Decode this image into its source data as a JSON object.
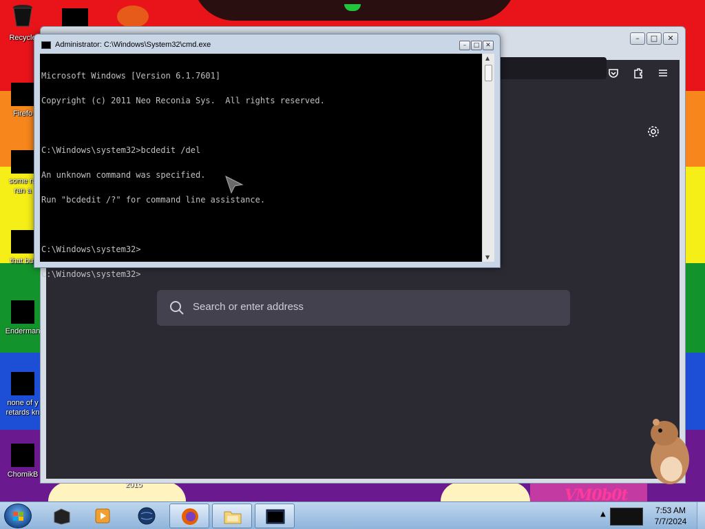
{
  "desktop": {
    "icons": [
      {
        "label": "Recycle",
        "icon": "recycle-bin-icon"
      },
      {
        "label": "Firefo",
        "icon": "firefox-icon"
      },
      {
        "label": "some ru",
        "label2": "ran a",
        "icon": "file-icon"
      },
      {
        "label": "that but",
        "icon": "file-icon"
      },
      {
        "label": "Enderman",
        "icon": "app-icon"
      },
      {
        "label": "none of y",
        "label2": "retards kn",
        "icon": "file-icon"
      },
      {
        "label": "ChomikB",
        "icon": "folder-icon"
      }
    ],
    "wallpaper_text": "VM0b0t",
    "wallpaper_year": "2015"
  },
  "browser": {
    "search_placeholder": "Search or enter address"
  },
  "cmd": {
    "title": "Administrator: C:\\Windows\\System32\\cmd.exe",
    "lines": [
      "Microsoft Windows [Version 6.1.7601]",
      "Copyright (c) 2011 Neo Reconia Sys.  All rights reserved.",
      "",
      "C:\\Windows\\system32>bcdedit /del",
      "An unknown command was specified.",
      "Run \"bcdedit /?\" for command line assistance.",
      "",
      "C:\\Windows\\system32>",
      "C:\\Windows\\system32>"
    ]
  },
  "taskbar": {
    "items": [
      {
        "name": "taskbar-item-terminal",
        "icon": "black-box-icon"
      },
      {
        "name": "taskbar-item-media-player",
        "icon": "media-player-icon"
      },
      {
        "name": "taskbar-item-globe",
        "icon": "globe-icon"
      },
      {
        "name": "taskbar-item-firefox",
        "icon": "firefox-icon",
        "active": true
      },
      {
        "name": "taskbar-item-explorer",
        "icon": "folder-icon",
        "active": true
      },
      {
        "name": "taskbar-item-cmd",
        "icon": "cmd-icon",
        "active": true
      }
    ],
    "clock": {
      "time": "7:53 AM",
      "date": "7/7/2024"
    }
  },
  "colors": {
    "firefox_bg": "#2b2a33",
    "firefox_search": "#42414d",
    "cmd_bg": "#000000",
    "cmd_text": "#c0c0c0"
  }
}
